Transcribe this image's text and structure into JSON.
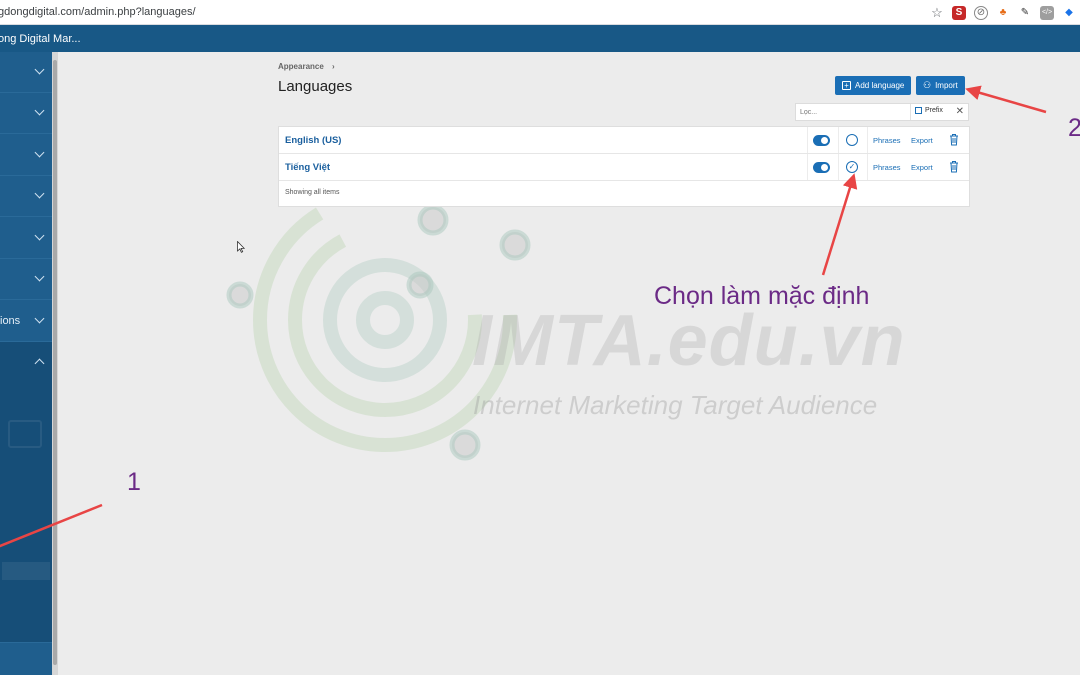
{
  "browser": {
    "url": "gdongdigital.com/admin.php?languages/"
  },
  "topbar": {
    "title": "ong Digital Mar..."
  },
  "sidebar": {
    "partial_label": "ions"
  },
  "breadcrumb": {
    "item": "Appearance",
    "separator": "›"
  },
  "page": {
    "title": "Languages"
  },
  "buttons": {
    "add_language": "Add language",
    "import": "Import"
  },
  "filter": {
    "placeholder": "Lọc...",
    "prefix_label": "Prefix",
    "clear": "✕"
  },
  "languages": [
    {
      "name": "English (US)",
      "enabled": true,
      "default": false,
      "phrases": "Phrases",
      "export": "Export"
    },
    {
      "name": "Tiếng Việt",
      "enabled": true,
      "default": true,
      "phrases": "Phrases",
      "export": "Export"
    }
  ],
  "table_footer": "Showing all items",
  "watermark": {
    "brand": "IMTA.edu.vn",
    "tagline": "Internet Marketing Target Audience"
  },
  "annotations": {
    "default_note": "Chọn làm mặc định",
    "marker_1": "1",
    "marker_2": "2"
  },
  "colors": {
    "accent": "#1a6eb5",
    "topbar": "#185886",
    "sidebar": "#1f5e8d",
    "annotation": "#6b2a86",
    "arrow": "#e84545"
  }
}
